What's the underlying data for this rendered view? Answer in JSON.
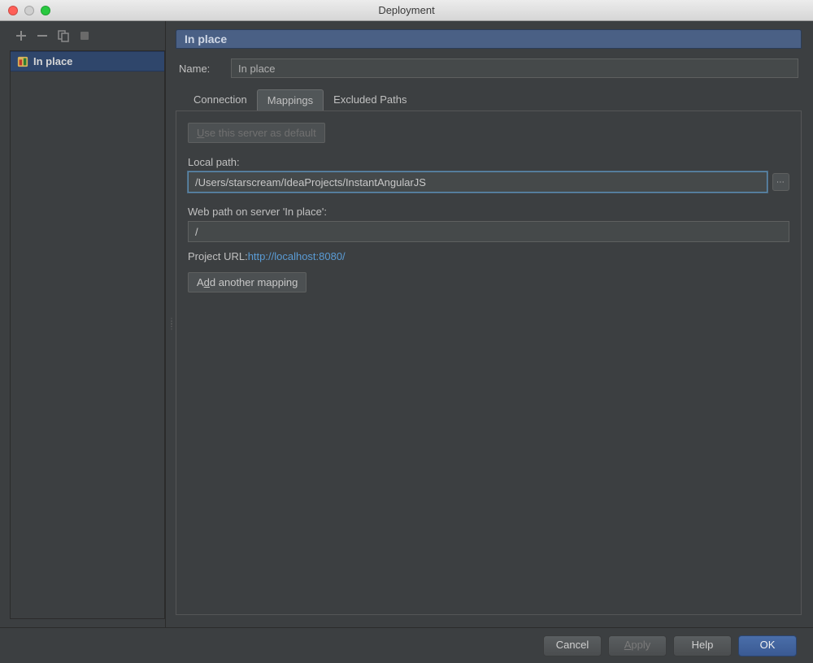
{
  "window": {
    "title": "Deployment"
  },
  "sidebar": {
    "items": [
      {
        "name": "In place"
      }
    ]
  },
  "header": {
    "title": "In place"
  },
  "nameRow": {
    "label": "Name:",
    "value": "In place"
  },
  "tabs": {
    "connection": "Connection",
    "mappings": "Mappings",
    "excluded": "Excluded Paths"
  },
  "content": {
    "defaultBtn": "Use this server as default",
    "localPathLabel": "Local path:",
    "localPath": "/Users/starscream/IdeaProjects/InstantAngularJS",
    "webPathLabel": "Web path on server 'In place':",
    "webPath": "/",
    "projectUrlLabel": "Project URL:",
    "projectUrl": "http://localhost:8080/",
    "addMapping": "Add another mapping"
  },
  "buttons": {
    "cancel": "Cancel",
    "apply": "Apply",
    "help": "Help",
    "ok": "OK"
  }
}
